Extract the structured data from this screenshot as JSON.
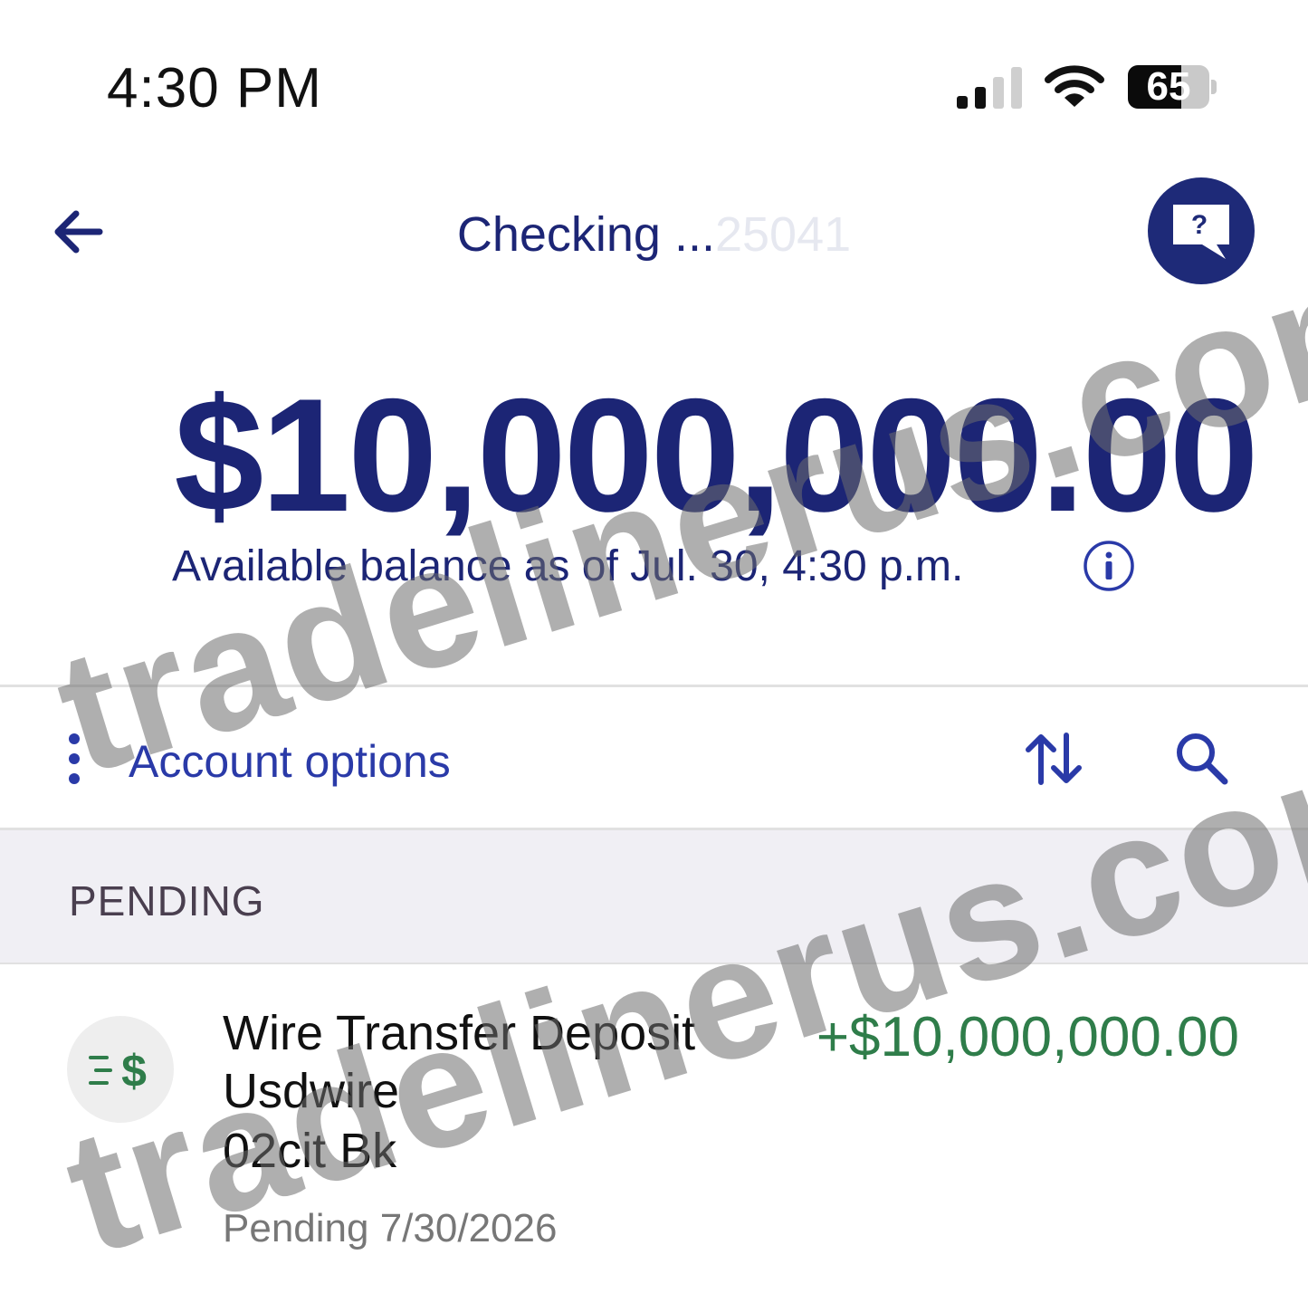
{
  "status_bar": {
    "time": "4:30 PM",
    "battery_level": "65",
    "battery_fraction": 0.65,
    "icons": [
      "cellular-signal-icon",
      "wifi-icon",
      "battery-icon"
    ]
  },
  "header": {
    "title": "Checking ...",
    "account_suffix": "25041",
    "back_icon": "arrow-left-icon",
    "help_icon": "help-chat-bubble-icon"
  },
  "balance": {
    "amount": "$10,000,000.00",
    "as_of": "Available balance as of Jul. 30, 4:30 p.m.",
    "info_icon": "info-icon"
  },
  "toolbar": {
    "account_options_label": "Account options",
    "icons": [
      "kebab-menu-icon",
      "sort-arrows-icon",
      "search-icon"
    ]
  },
  "pending": {
    "section_label": "PENDING",
    "transactions": [
      {
        "icon": "wire-transfer-dollar-icon",
        "line1": "Wire Transfer Deposit",
        "line2": "Usdwire",
        "line3": "02cit Bk",
        "amount": "+$10,000,000.00",
        "status": "Pending 7/30/2026"
      }
    ]
  },
  "watermark": {
    "text": "tradelinerus.com"
  },
  "colors": {
    "navy": "#1c2575",
    "link_blue": "#2a3aa8",
    "credit_green": "#2f7d4a",
    "section_bg": "#f0eff4"
  }
}
